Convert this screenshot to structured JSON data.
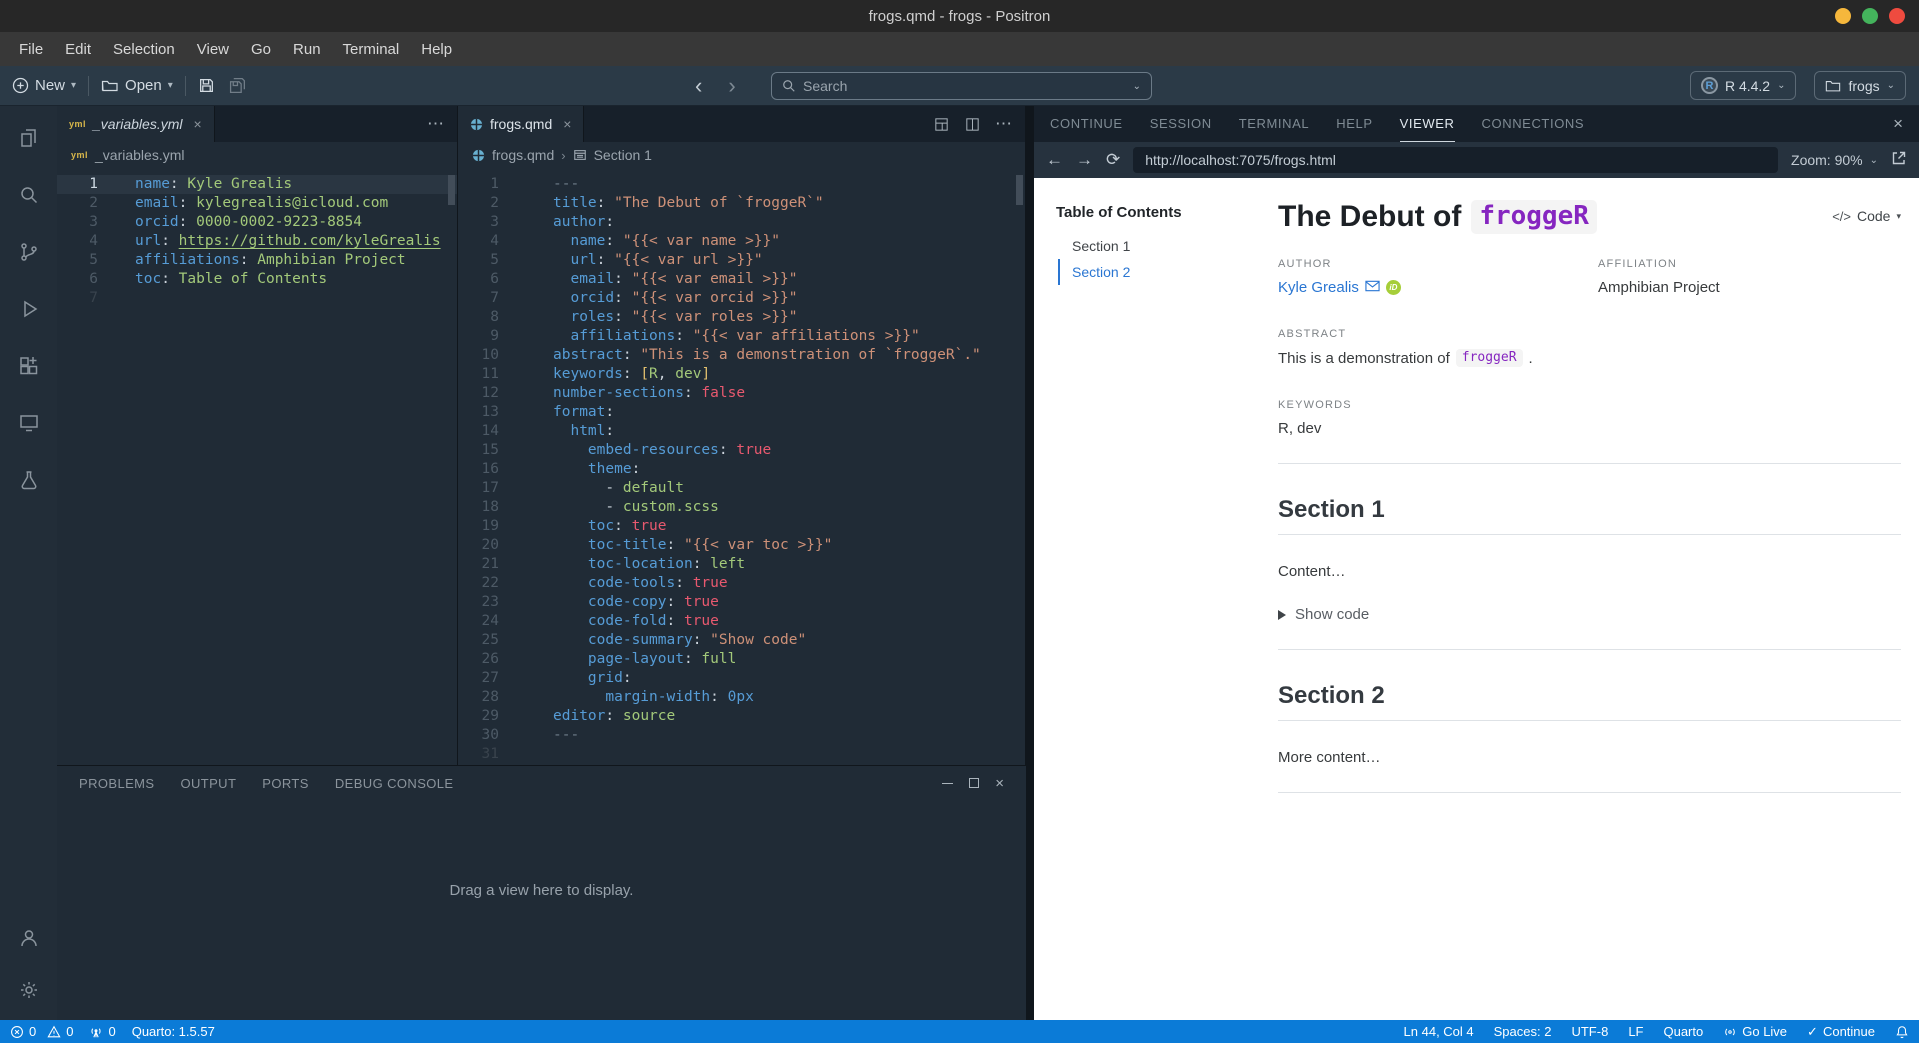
{
  "window": {
    "title": "frogs.qmd - frogs - Positron"
  },
  "menu": {
    "items": [
      "File",
      "Edit",
      "Selection",
      "View",
      "Go",
      "Run",
      "Terminal",
      "Help"
    ]
  },
  "toolbar": {
    "new_label": "New",
    "open_label": "Open",
    "search_placeholder": "Search",
    "r_runtime": "R 4.4.2",
    "workspace": "frogs"
  },
  "glyphs": {
    "more": "⋯",
    "caret_down": "▾",
    "chevron_down": "⌄",
    "back": "‹",
    "forward": "›",
    "arrow_left": "←",
    "arrow_right": "→",
    "reload": "⟳",
    "close": "×",
    "check": "✓",
    "breadcrumb_sep": "›",
    "plus": "⊕",
    "code_tag": "</>"
  },
  "editors": {
    "left": {
      "tab_label": "_variables.yml",
      "file_icon": "yml",
      "breadcrumb_file": "_variables.yml",
      "lines": [
        {
          "n": 1,
          "active": true,
          "t": [
            [
              "k",
              "name"
            ],
            [
              "w",
              ": "
            ],
            [
              "g",
              "Kyle Grealis"
            ]
          ]
        },
        {
          "n": 2,
          "t": [
            [
              "k",
              "email"
            ],
            [
              "w",
              ": "
            ],
            [
              "g",
              "kylegrealis@icloud.com"
            ]
          ]
        },
        {
          "n": 3,
          "t": [
            [
              "k",
              "orcid"
            ],
            [
              "w",
              ": "
            ],
            [
              "g",
              "0000-0002-9223-8854"
            ]
          ]
        },
        {
          "n": 4,
          "t": [
            [
              "k",
              "url"
            ],
            [
              "w",
              ": "
            ],
            [
              "u",
              "https://github.com/kyleGrealis"
            ]
          ]
        },
        {
          "n": 5,
          "t": [
            [
              "k",
              "affiliations"
            ],
            [
              "w",
              ": "
            ],
            [
              "g",
              "Amphibian Project"
            ]
          ]
        },
        {
          "n": 6,
          "t": [
            [
              "k",
              "toc"
            ],
            [
              "w",
              ": "
            ],
            [
              "g",
              "Table of Contents"
            ]
          ]
        },
        {
          "n": 7,
          "faint": true,
          "t": []
        }
      ]
    },
    "right": {
      "tab_label": "frogs.qmd",
      "breadcrumb_file": "frogs.qmd",
      "breadcrumb_section": "Section 1",
      "lines": [
        {
          "n": 1,
          "t": [
            [
              "c",
              "---"
            ]
          ]
        },
        {
          "n": 2,
          "t": [
            [
              "k",
              "title"
            ],
            [
              "w",
              ": "
            ],
            [
              "s",
              "\"The Debut of `froggeR`\""
            ]
          ]
        },
        {
          "n": 3,
          "t": [
            [
              "k",
              "author"
            ],
            [
              "w",
              ":"
            ]
          ]
        },
        {
          "n": 4,
          "t": [
            [
              "w",
              "  "
            ],
            [
              "k",
              "name"
            ],
            [
              "w",
              ": "
            ],
            [
              "s",
              "\"{{< var name >}}\""
            ]
          ]
        },
        {
          "n": 5,
          "t": [
            [
              "w",
              "  "
            ],
            [
              "k",
              "url"
            ],
            [
              "w",
              ": "
            ],
            [
              "s",
              "\"{{< var url >}}\""
            ]
          ]
        },
        {
          "n": 6,
          "t": [
            [
              "w",
              "  "
            ],
            [
              "k",
              "email"
            ],
            [
              "w",
              ": "
            ],
            [
              "s",
              "\"{{< var email >}}\""
            ]
          ]
        },
        {
          "n": 7,
          "t": [
            [
              "w",
              "  "
            ],
            [
              "k",
              "orcid"
            ],
            [
              "w",
              ": "
            ],
            [
              "s",
              "\"{{< var orcid >}}\""
            ]
          ]
        },
        {
          "n": 8,
          "t": [
            [
              "w",
              "  "
            ],
            [
              "k",
              "roles"
            ],
            [
              "w",
              ": "
            ],
            [
              "s",
              "\"{{< var roles >}}\""
            ]
          ]
        },
        {
          "n": 9,
          "t": [
            [
              "w",
              "  "
            ],
            [
              "k",
              "affiliations"
            ],
            [
              "w",
              ": "
            ],
            [
              "s",
              "\"{{< var affiliations >}}\""
            ]
          ]
        },
        {
          "n": 10,
          "t": [
            [
              "k",
              "abstract"
            ],
            [
              "w",
              ": "
            ],
            [
              "s",
              "\"This is a demonstration of `froggeR`.\""
            ]
          ]
        },
        {
          "n": 11,
          "t": [
            [
              "k",
              "keywords"
            ],
            [
              "w",
              ": "
            ],
            [
              "y",
              "["
            ],
            [
              "g",
              "R"
            ],
            [
              "w",
              ", "
            ],
            [
              "g",
              "dev"
            ],
            [
              "y",
              "]"
            ]
          ]
        },
        {
          "n": 12,
          "t": [
            [
              "k",
              "number-sections"
            ],
            [
              "w",
              ": "
            ],
            [
              "b",
              "false"
            ]
          ]
        },
        {
          "n": 13,
          "t": [
            [
              "k",
              "format"
            ],
            [
              "w",
              ":"
            ]
          ]
        },
        {
          "n": 14,
          "t": [
            [
              "w",
              "  "
            ],
            [
              "k",
              "html"
            ],
            [
              "w",
              ":"
            ]
          ]
        },
        {
          "n": 15,
          "t": [
            [
              "w",
              "    "
            ],
            [
              "k",
              "embed-resources"
            ],
            [
              "w",
              ": "
            ],
            [
              "b",
              "true"
            ]
          ]
        },
        {
          "n": 16,
          "t": [
            [
              "w",
              "    "
            ],
            [
              "k",
              "theme"
            ],
            [
              "w",
              ":"
            ]
          ]
        },
        {
          "n": 17,
          "t": [
            [
              "w",
              "      - "
            ],
            [
              "g",
              "default"
            ]
          ]
        },
        {
          "n": 18,
          "t": [
            [
              "w",
              "      - "
            ],
            [
              "g",
              "custom.scss"
            ]
          ]
        },
        {
          "n": 19,
          "t": [
            [
              "w",
              "    "
            ],
            [
              "k",
              "toc"
            ],
            [
              "w",
              ": "
            ],
            [
              "b",
              "true"
            ]
          ]
        },
        {
          "n": 20,
          "t": [
            [
              "w",
              "    "
            ],
            [
              "k",
              "toc-title"
            ],
            [
              "w",
              ": "
            ],
            [
              "s",
              "\"{{< var toc >}}\""
            ]
          ]
        },
        {
          "n": 21,
          "t": [
            [
              "w",
              "    "
            ],
            [
              "k",
              "toc-location"
            ],
            [
              "w",
              ": "
            ],
            [
              "g",
              "left"
            ]
          ]
        },
        {
          "n": 22,
          "t": [
            [
              "w",
              "    "
            ],
            [
              "k",
              "code-tools"
            ],
            [
              "w",
              ": "
            ],
            [
              "b",
              "true"
            ]
          ]
        },
        {
          "n": 23,
          "t": [
            [
              "w",
              "    "
            ],
            [
              "k",
              "code-copy"
            ],
            [
              "w",
              ": "
            ],
            [
              "b",
              "true"
            ]
          ]
        },
        {
          "n": 24,
          "t": [
            [
              "w",
              "    "
            ],
            [
              "k",
              "code-fold"
            ],
            [
              "w",
              ": "
            ],
            [
              "b",
              "true"
            ]
          ]
        },
        {
          "n": 25,
          "t": [
            [
              "w",
              "    "
            ],
            [
              "k",
              "code-summary"
            ],
            [
              "w",
              ": "
            ],
            [
              "s",
              "\"Show code\""
            ]
          ]
        },
        {
          "n": 26,
          "t": [
            [
              "w",
              "    "
            ],
            [
              "k",
              "page-layout"
            ],
            [
              "w",
              ": "
            ],
            [
              "g",
              "full"
            ]
          ]
        },
        {
          "n": 27,
          "t": [
            [
              "w",
              "    "
            ],
            [
              "k",
              "grid"
            ],
            [
              "w",
              ":"
            ]
          ]
        },
        {
          "n": 28,
          "t": [
            [
              "w",
              "      "
            ],
            [
              "k",
              "margin-width"
            ],
            [
              "w",
              ": "
            ],
            [
              "n",
              "0px"
            ]
          ]
        },
        {
          "n": 29,
          "t": [
            [
              "k",
              "editor"
            ],
            [
              "w",
              ": "
            ],
            [
              "g",
              "source"
            ]
          ]
        },
        {
          "n": 30,
          "t": [
            [
              "c",
              "---"
            ]
          ]
        },
        {
          "n": 31,
          "faint": true,
          "t": []
        }
      ]
    }
  },
  "bottom_panel": {
    "tabs": [
      "PROBLEMS",
      "OUTPUT",
      "PORTS",
      "DEBUG CONSOLE"
    ],
    "empty_text": "Drag a view here to display."
  },
  "right_panel": {
    "tabs": [
      "CONTINUE",
      "SESSION",
      "TERMINAL",
      "HELP",
      "VIEWER",
      "CONNECTIONS"
    ],
    "active_tab": "VIEWER",
    "url": "http://localhost:7075/frogs.html",
    "zoom_label": "Zoom: 90%"
  },
  "viewer": {
    "toc_title": "Table of Contents",
    "toc_items": [
      "Section 1",
      "Section 2"
    ],
    "code_button_label": "Code",
    "title_text": "The Debut of",
    "title_code": "froggeR",
    "author_label": "AUTHOR",
    "author_name": "Kyle Grealis",
    "orcid_badge": "iD",
    "affiliation_label": "AFFILIATION",
    "affiliation": "Amphibian Project",
    "abstract_label": "ABSTRACT",
    "abstract_text": "This is a demonstration of",
    "abstract_code": "froggeR",
    "abstract_period": ".",
    "keywords_label": "KEYWORDS",
    "keywords": "R, dev",
    "section1_heading": "Section 1",
    "section1_body": "Content…",
    "show_code_label": "Show code",
    "section2_heading": "Section 2",
    "section2_body": "More content…"
  },
  "status_bar": {
    "errors": "0",
    "warnings": "0",
    "ports": "0",
    "quarto": "Quarto: 1.5.57",
    "line_col": "Ln 44, Col 4",
    "spaces": "Spaces: 2",
    "encoding": "UTF-8",
    "eol": "LF",
    "language": "Quarto",
    "go_live": "Go Live",
    "continue_label": "Continue"
  },
  "colors": {
    "status_bg": "#0b7bd7",
    "accent_link": "#2a76d2",
    "code_purple": "#8626c0",
    "orcid_green": "#a6ce39",
    "traffic_yellow": "#f6b73c",
    "traffic_green": "#44b35c",
    "traffic_red": "#ef4b3f",
    "syntax_key": "#569cd6",
    "syntax_string": "#ce9178",
    "syntax_scalar": "#a3c97a",
    "syntax_bool": "#e8596f"
  }
}
